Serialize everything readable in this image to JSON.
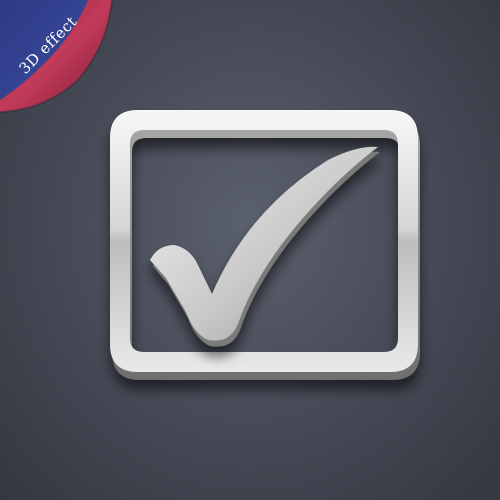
{
  "badge": {
    "text": "3D effect",
    "ribbon_color": "#2f3f8a",
    "fold_color": "#b5304e"
  },
  "icon": {
    "name": "checkbox-checked-icon",
    "metal_light": "#f2f2f2",
    "metal_dark": "#9a9a9a",
    "background": "#4a4f5b"
  }
}
